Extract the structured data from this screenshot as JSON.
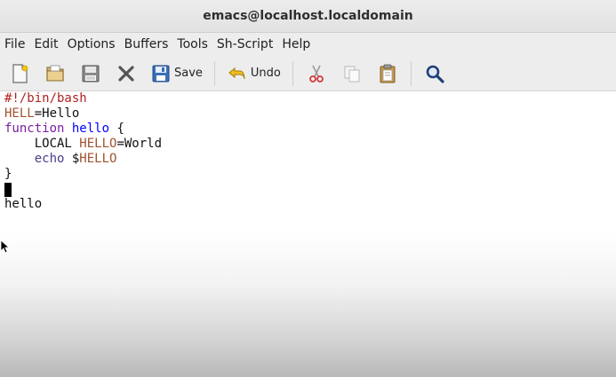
{
  "window": {
    "title": "emacs@localhost.localdomain"
  },
  "menubar": {
    "items": [
      "File",
      "Edit",
      "Options",
      "Buffers",
      "Tools",
      "Sh-Script",
      "Help"
    ]
  },
  "toolbar": {
    "new_icon": "new-file-icon",
    "open_icon": "open-folder-icon",
    "save_disk_icon": "floppy-icon",
    "close_icon": "close-x-icon",
    "save_label": "Save",
    "undo_label": "Undo",
    "cut_icon": "scissors-icon",
    "copy_icon": "copy-icon",
    "paste_icon": "paste-icon",
    "search_icon": "magnifier-icon"
  },
  "buffer": {
    "lines": [
      {
        "tokens": [
          {
            "text": "#!/bin/bash",
            "kind": "comment"
          }
        ]
      },
      {
        "tokens": [
          {
            "text": "HELL",
            "kind": "var"
          },
          {
            "text": "=Hello",
            "kind": "plain"
          }
        ]
      },
      {
        "tokens": [
          {
            "text": "function",
            "kind": "kw"
          },
          {
            "text": " ",
            "kind": "plain"
          },
          {
            "text": "hello",
            "kind": "fn"
          },
          {
            "text": " {",
            "kind": "plain"
          }
        ]
      },
      {
        "tokens": [
          {
            "text": "    LOCAL ",
            "kind": "plain"
          },
          {
            "text": "HELLO",
            "kind": "var"
          },
          {
            "text": "=World",
            "kind": "plain"
          }
        ]
      },
      {
        "tokens": [
          {
            "text": "    ",
            "kind": "plain"
          },
          {
            "text": "echo",
            "kind": "builtin"
          },
          {
            "text": " $",
            "kind": "plain"
          },
          {
            "text": "HELLO",
            "kind": "var"
          }
        ]
      },
      {
        "tokens": [
          {
            "text": "}",
            "kind": "plain"
          }
        ]
      },
      {
        "tokens": [],
        "cursor": true
      },
      {
        "tokens": [
          {
            "text": "hello",
            "kind": "plain"
          }
        ]
      }
    ]
  },
  "colors": {
    "comment": "#b22222",
    "var": "#a0522d",
    "keyword": "#7a1fa2",
    "function": "#0000ff",
    "builtin": "#483d8b"
  }
}
